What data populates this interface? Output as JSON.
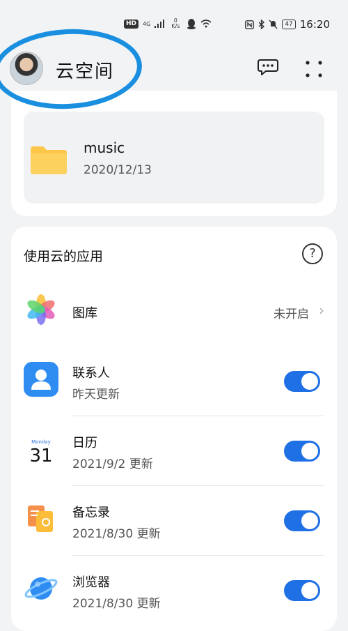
{
  "status_bar": {
    "hd": "HD",
    "network": "4G",
    "speed_value": "0",
    "speed_unit": "K/s",
    "battery": "47",
    "time": "16:20"
  },
  "header": {
    "title": "云空间"
  },
  "file": {
    "name": "music",
    "date": "2020/12/13"
  },
  "apps_section": {
    "title": "使用云的应用",
    "help": "?",
    "items": [
      {
        "name": "图库",
        "status": "未开启",
        "enabled": false,
        "icon": "gallery-icon"
      },
      {
        "name": "联系人",
        "subtitle": "昨天更新",
        "enabled": true,
        "icon": "contacts-icon"
      },
      {
        "name": "日历",
        "subtitle": "2021/9/2 更新",
        "enabled": true,
        "icon": "calendar-icon",
        "calendar_weekday": "Monday",
        "calendar_day": "31"
      },
      {
        "name": "备忘录",
        "subtitle": "2021/8/30 更新",
        "enabled": true,
        "icon": "notes-icon"
      },
      {
        "name": "浏览器",
        "subtitle": "2021/8/30 更新",
        "enabled": true,
        "icon": "browser-icon"
      }
    ]
  },
  "colors": {
    "accent": "#1f6fe5",
    "annotation_ring": "#1a8fe0",
    "folder": "#fcc64a",
    "background": "#f1f3f5"
  }
}
